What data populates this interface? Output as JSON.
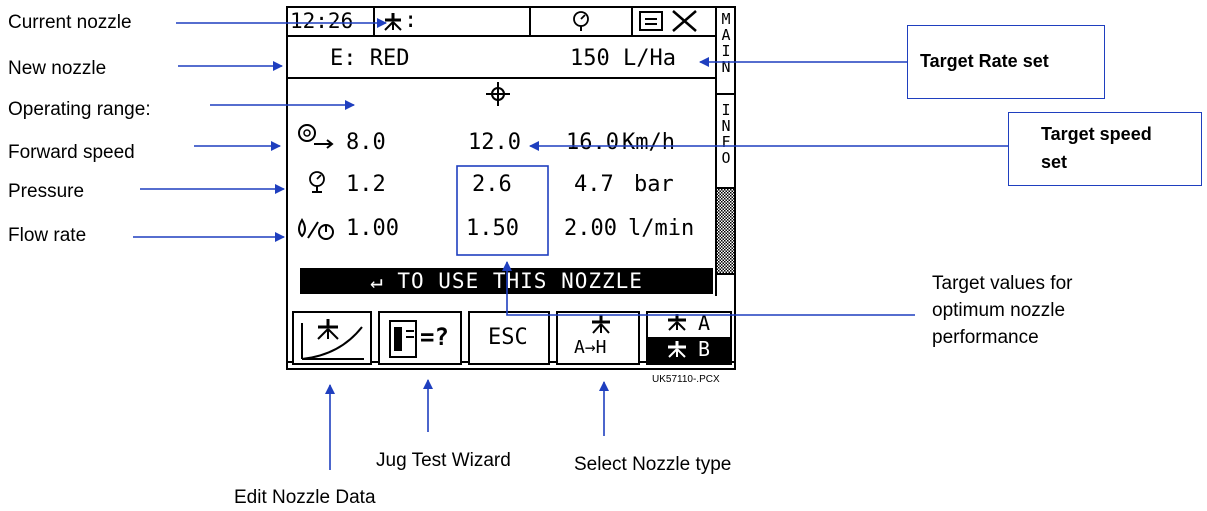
{
  "annotations": {
    "current_nozzle": "Current nozzle",
    "new_nozzle": "New nozzle",
    "operating_range": "Operating range:",
    "forward_speed": "Forward speed",
    "pressure": "Pressure",
    "flow_rate": "Flow rate",
    "target_rate_set": "Target Rate set",
    "target_speed_set_line1": "Target speed",
    "target_speed_set_line2": "set",
    "target_values_line1": "Target values for",
    "target_values_line2": "optimum nozzle",
    "target_values_line3": "performance",
    "jug_test_wizard": "Jug Test Wizard",
    "select_nozzle_type": "Select Nozzle type",
    "edit_nozzle_data": "Edit Nozzle Data",
    "file_name": "UK57110-.PCX"
  },
  "screen": {
    "time": "12:26",
    "nozzle_status": ":",
    "new_nozzle_label": "E: RED",
    "target_rate": "150 L/Ha",
    "side_tabs": {
      "main": [
        "M",
        "A",
        "I",
        "N"
      ],
      "info": [
        "I",
        "N",
        "F",
        "O"
      ]
    },
    "speed": {
      "min": "8.0",
      "target": "12.0",
      "max": "16.0",
      "unit": "Km/h"
    },
    "pressure": {
      "min": "1.2",
      "target": "2.6",
      "max": "4.7",
      "unit": "bar"
    },
    "flow": {
      "min": "1.00",
      "target": "1.50",
      "max": "2.00",
      "unit": "l/min"
    },
    "banner": "↵ TO USE THIS NOZZLE",
    "softkeys": {
      "esc": "ESC",
      "jug_test": "=?",
      "select_range": "A→H",
      "nozzle_a": "A",
      "nozzle_b": "B"
    }
  },
  "colors": {
    "arrow": "#1f3fbf",
    "lcd_ink": "#000000",
    "lcd_bg": "#ffffff"
  }
}
